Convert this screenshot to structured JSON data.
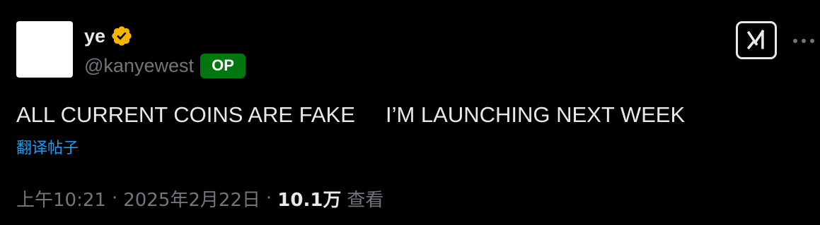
{
  "author": {
    "display_name": "ye",
    "handle": "@kanyewest",
    "op_badge": "OP",
    "verified_icon": "verified-badge-icon",
    "verified_color": "#f4b400"
  },
  "actions": {
    "grok_icon": "grok-icon",
    "more_icon": "more-horizontal-icon"
  },
  "tweet": {
    "text": "ALL CURRENT COINS ARE FAKE     I’M LAUNCHING NEXT WEEK",
    "translate_label": "翻译帖子"
  },
  "meta": {
    "time": "上午10:21",
    "separator": "·",
    "date": "2025年2月22日",
    "views_count": "10.1万",
    "views_label": "查看"
  },
  "colors": {
    "background": "#000000",
    "primary_text": "#e7e9ea",
    "secondary_text": "#71767b",
    "link": "#1d9bf0",
    "op_badge_bg": "#00770f"
  }
}
